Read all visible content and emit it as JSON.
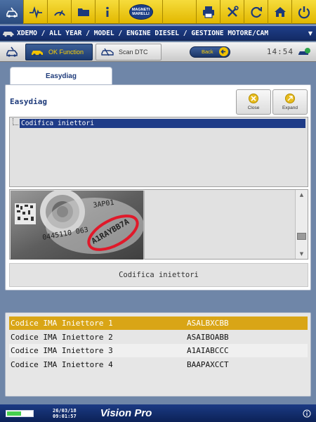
{
  "toolbar": {
    "brand_logo": {
      "line1": "MAGNETI",
      "line2": "MARELLI"
    },
    "left_icons": [
      "car-diagnosis-icon",
      "waveform-icon",
      "gauge-icon",
      "folder-icon",
      "info-icon"
    ],
    "right_icons": [
      "printer-icon",
      "tools-icon",
      "refresh-icon",
      "home-icon",
      "power-icon"
    ],
    "colors": {
      "bar": "#e9c400",
      "active": "#2a4a7d"
    }
  },
  "breadcrumb": {
    "text": "XDEMO / ALL YEAR / MODEL / ENGINE DIESEL / GESTIONE MOTORE/CAM",
    "dropdown_icon": "chevron-down-icon"
  },
  "functionbar": {
    "ok_function_label": "OK Function",
    "scan_dtc_label": "Scan DTC",
    "back_label": "Back",
    "clock": "14:54"
  },
  "main": {
    "tab_label": "Easydiag",
    "panel_title": "Easydiag",
    "close_label": "Close",
    "expand_label": "Expand",
    "tree_item": "Codifica iniettori",
    "photo": {
      "code_text": "A1RAYBB7A",
      "serial_text": "0445110 063",
      "ring_text": "3AP01"
    },
    "caption": "Codifica iniettori"
  },
  "results": {
    "rows": [
      {
        "label": "Codice IMA Iniettore 1",
        "value": "ASALBXCBB",
        "selected": true
      },
      {
        "label": "Codice IMA Iniettore 2",
        "value": "ASAIBOABB",
        "selected": false
      },
      {
        "label": "Codice IMA Iniettore 3",
        "value": "A1AIABCCC",
        "selected": false
      },
      {
        "label": "Codice IMA Iniettore 4",
        "value": "BAAPAXCCT",
        "selected": false
      }
    ],
    "selected_color": "#d9a516"
  },
  "statusbar": {
    "date": "26/03/18",
    "time": "09:01:57",
    "brand": "Vision Pro",
    "battery_level": 0.55
  }
}
